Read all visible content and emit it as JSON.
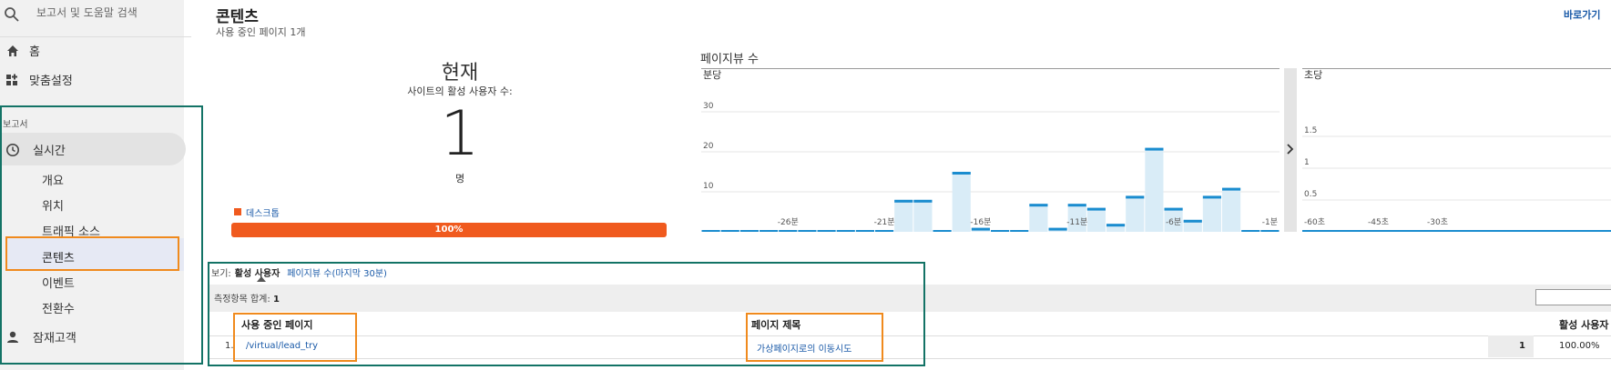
{
  "sidebar": {
    "search_placeholder": "보고서 및 도움말 검색",
    "home": "홈",
    "customization": "맞춤설정",
    "section_reports": "보고서",
    "realtime": "실시간",
    "realtime_items": [
      {
        "label": "개요"
      },
      {
        "label": "위치"
      },
      {
        "label": "트래픽 소스"
      },
      {
        "label": "콘텐츠"
      },
      {
        "label": "이벤트"
      },
      {
        "label": "전환수"
      }
    ],
    "audience": "잠재고객"
  },
  "header": {
    "title": "콘텐츠",
    "subtitle": "사용 중인 페이지 1개",
    "shortcut_link": "바로가기"
  },
  "current": {
    "label": "현재",
    "active_users_label": "사이트의 활성 사용자 수:",
    "count": "1",
    "unit": "명",
    "device_legend": "데스크톱",
    "device_percent_label": "100%",
    "device_share": 1.0
  },
  "pageviews": {
    "title": "페이지뷰 수"
  },
  "colors": {
    "accent_orange": "#f05a1e",
    "chart_bar_fill": "#d9ecf7",
    "chart_bar_top": "#1a8ccf",
    "teal_border": "#137366",
    "orange_border": "#f08a1d"
  },
  "chart_data": [
    {
      "type": "bar",
      "title": "",
      "ylabel": "분당",
      "ylim": [
        0,
        30
      ],
      "yticks": [
        10,
        20,
        30
      ],
      "x_ticks": [
        "-26분",
        "-21분",
        "-16분",
        "-11분",
        "-6분",
        "-1분"
      ],
      "x": [
        -30,
        -29,
        -28,
        -27,
        -26,
        -25,
        -24,
        -23,
        -22,
        -21,
        -20,
        -19,
        -18,
        -17,
        -16,
        -15,
        -14,
        -13,
        -12,
        -11,
        -10,
        -9,
        -8,
        -7,
        -6,
        -5,
        -4,
        -3,
        -2,
        -1
      ],
      "values": [
        0,
        0,
        0,
        0,
        0,
        0,
        0,
        0,
        0,
        0,
        8,
        8,
        0,
        15,
        1,
        0,
        0,
        7,
        1,
        7,
        6,
        2,
        9,
        21,
        6,
        3,
        9,
        11,
        0,
        0
      ]
    },
    {
      "type": "bar",
      "title": "",
      "ylabel": "초당",
      "ylim": [
        0,
        2
      ],
      "yticks": [
        0.5,
        1,
        1.5
      ],
      "x_ticks": [
        "-60초",
        "-45초",
        "-30초"
      ],
      "values": []
    }
  ],
  "table": {
    "view_label": "보기:",
    "view_active": "활성 사용자",
    "view_link": "페이지뷰 수(마지막 30분)",
    "totals_label": "측정항목 합계:",
    "totals_value": "1",
    "columns": {
      "page": "사용 중인 페이지",
      "title": "페이지 제목",
      "active": "활성 사용자"
    },
    "rows": [
      {
        "index": "1.",
        "page": "/virtual/lead_try",
        "title": "가상페이지로의 이동시도",
        "active": "1",
        "percent": "100.00%"
      }
    ]
  }
}
